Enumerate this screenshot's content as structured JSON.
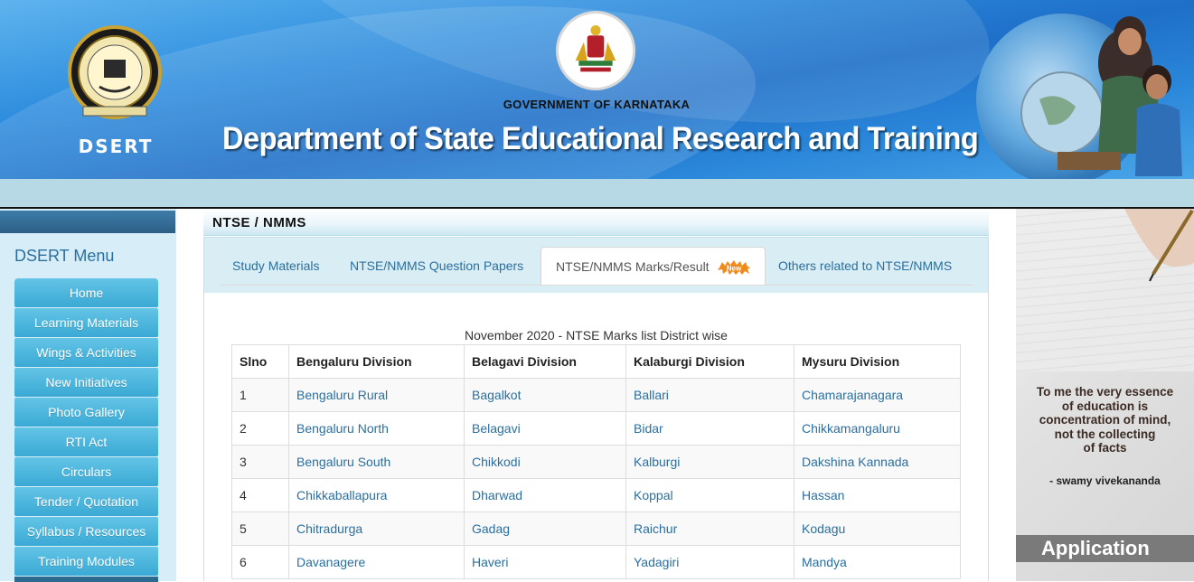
{
  "banner": {
    "logo_text": "DSERT",
    "government": "GOVERNMENT OF KARNATAKA",
    "department": "Department of State Educational Research and Training"
  },
  "sidebar": {
    "title": "DSERT Menu",
    "items": [
      {
        "label": "Home"
      },
      {
        "label": "Learning Materials"
      },
      {
        "label": "Wings & Activities"
      },
      {
        "label": "New Initiatives"
      },
      {
        "label": "Photo Gallery"
      },
      {
        "label": "RTI Act"
      },
      {
        "label": "Circulars"
      },
      {
        "label": "Tender / Quotation"
      },
      {
        "label": "Syllabus / Resources"
      },
      {
        "label": "Training Modules"
      }
    ]
  },
  "page": {
    "header": "NTSE / NMMS",
    "tabs": [
      {
        "label": "Study Materials",
        "active": false
      },
      {
        "label": "NTSE/NMMS Question Papers",
        "active": false
      },
      {
        "label": "NTSE/NMMS Marks/Result",
        "active": true,
        "badge": "New"
      },
      {
        "label": "Others related to NTSE/NMMS",
        "active": false
      }
    ],
    "caption": "November 2020 - NTSE Marks list District wise",
    "table": {
      "headers": [
        "Slno",
        "Bengaluru Division",
        "Belagavi Division",
        "Kalaburgi Division",
        "Mysuru Division"
      ],
      "rows": [
        [
          "1",
          "Bengaluru Rural",
          "Bagalkot",
          "Ballari",
          "Chamarajanagara"
        ],
        [
          "2",
          "Bengaluru North",
          "Belagavi",
          "Bidar",
          "Chikkamangaluru"
        ],
        [
          "3",
          "Bengaluru South",
          "Chikkodi",
          "Kalburgi",
          "Dakshina Kannada"
        ],
        [
          "4",
          "Chikkaballapura",
          "Dharwad",
          "Koppal",
          "Hassan"
        ],
        [
          "5",
          "Chitradurga",
          "Gadag",
          "Raichur",
          "Kodagu"
        ],
        [
          "6",
          "Davanagere",
          "Haveri",
          "Yadagiri",
          "Mandya"
        ]
      ]
    }
  },
  "ad": {
    "quote_lines": [
      "To me the very essence",
      "of education is",
      "concentration of mind,",
      "not the collecting",
      "of facts"
    ],
    "author": "- swamy vivekananda",
    "button": "Application"
  }
}
